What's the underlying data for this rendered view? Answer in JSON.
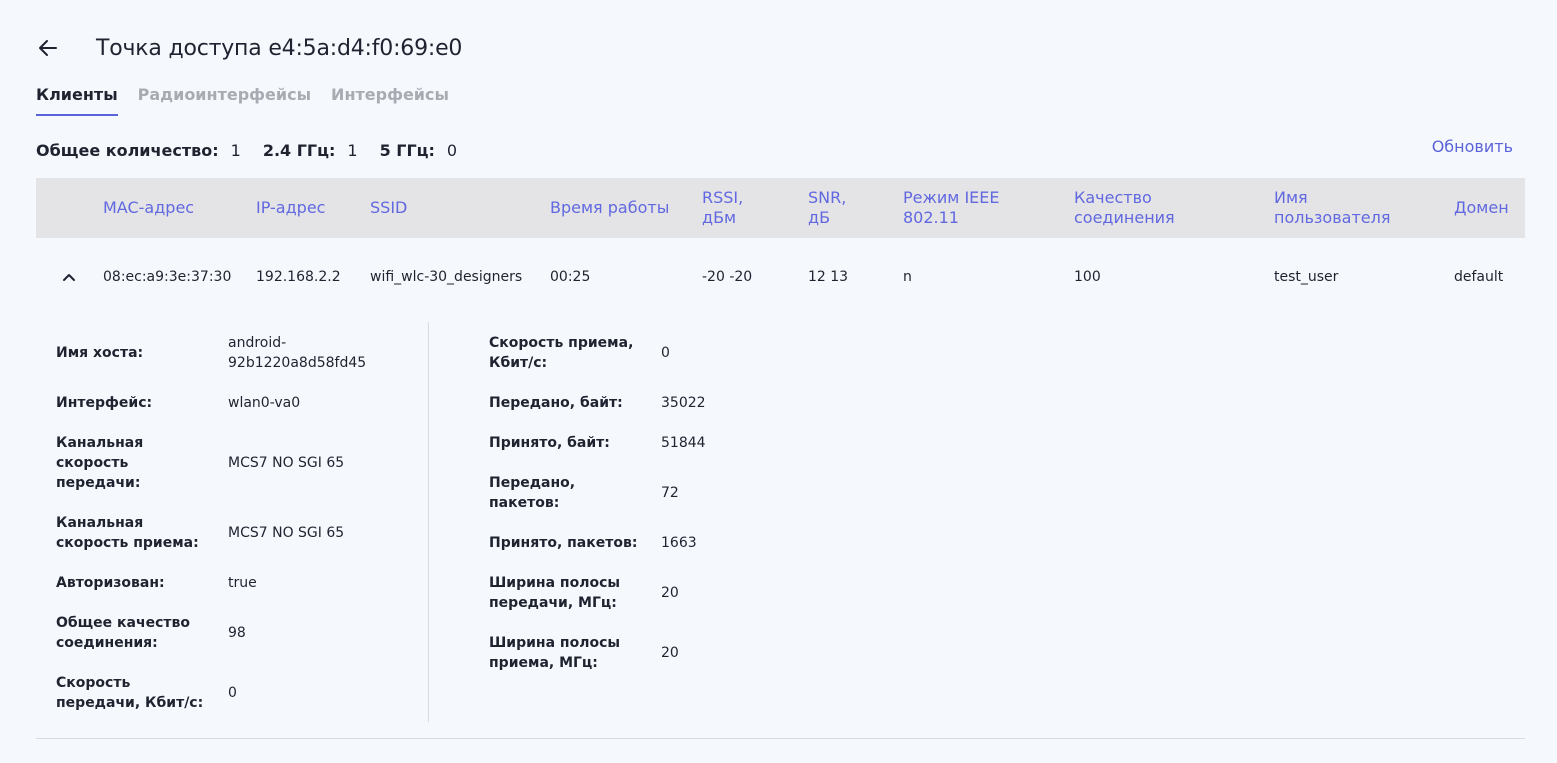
{
  "header": {
    "title": "Точка доступа e4:5a:d4:f0:69:e0"
  },
  "tabs": [
    {
      "label": "Клиенты",
      "active": true
    },
    {
      "label": "Радиоинтерфейсы",
      "active": false
    },
    {
      "label": "Интерфейсы",
      "active": false
    }
  ],
  "counts": {
    "total_label": "Общее количество:",
    "total_value": "1",
    "g24_label": "2.4 ГГц:",
    "g24_value": "1",
    "g5_label": "5 ГГц:",
    "g5_value": "0"
  },
  "refresh_label": "Обновить",
  "columns": {
    "mac": "MAC-адрес",
    "ip": "IP-адрес",
    "ssid": "SSID",
    "uptime": "Время работы",
    "rssi": "RSSI, дБм",
    "snr": "SNR, дБ",
    "ieee": "Режим IEEE 802.11",
    "quality": "Качество соединения",
    "user": "Имя пользователя",
    "domain": "Домен"
  },
  "row": {
    "mac": "08:ec:a9:3e:37:30",
    "ip": "192.168.2.2",
    "ssid": "wifi_wlc-30_designers",
    "uptime": "00:25",
    "rssi": "-20 -20",
    "snr": "12 13",
    "ieee": "n",
    "quality": "100",
    "user": "test_user",
    "domain": "default"
  },
  "details": {
    "left": [
      {
        "label": "Имя хоста:",
        "value": "android-92b1220a8d58fd45"
      },
      {
        "label": "Интерфейс:",
        "value": "wlan0-va0"
      },
      {
        "label": "Канальная скорость передачи:",
        "value": "MCS7 NO SGI 65"
      },
      {
        "label": "Канальная скорость приема:",
        "value": "MCS7 NO SGI 65"
      },
      {
        "label": "Авторизован:",
        "value": "true"
      },
      {
        "label": "Общее качество соединения:",
        "value": "98"
      },
      {
        "label": "Скорость передачи, Кбит/с:",
        "value": "0"
      }
    ],
    "right": [
      {
        "label": "Скорость приема, Кбит/с:",
        "value": "0"
      },
      {
        "label": "Передано, байт:",
        "value": "35022"
      },
      {
        "label": "Принято, байт:",
        "value": "51844"
      },
      {
        "label": "Передано, пакетов:",
        "value": "72"
      },
      {
        "label": "Принято, пакетов:",
        "value": "1663"
      },
      {
        "label": "Ширина полосы передачи, МГц:",
        "value": "20"
      },
      {
        "label": "Ширина полосы приема, МГц:",
        "value": "20"
      }
    ]
  },
  "colors": {
    "accent": "#5b63d9",
    "header_bg": "#e4e4e6",
    "page_bg": "#f5f8fd"
  },
  "icons": {
    "back": "arrow-left-icon",
    "collapse": "chevron-up-icon"
  }
}
